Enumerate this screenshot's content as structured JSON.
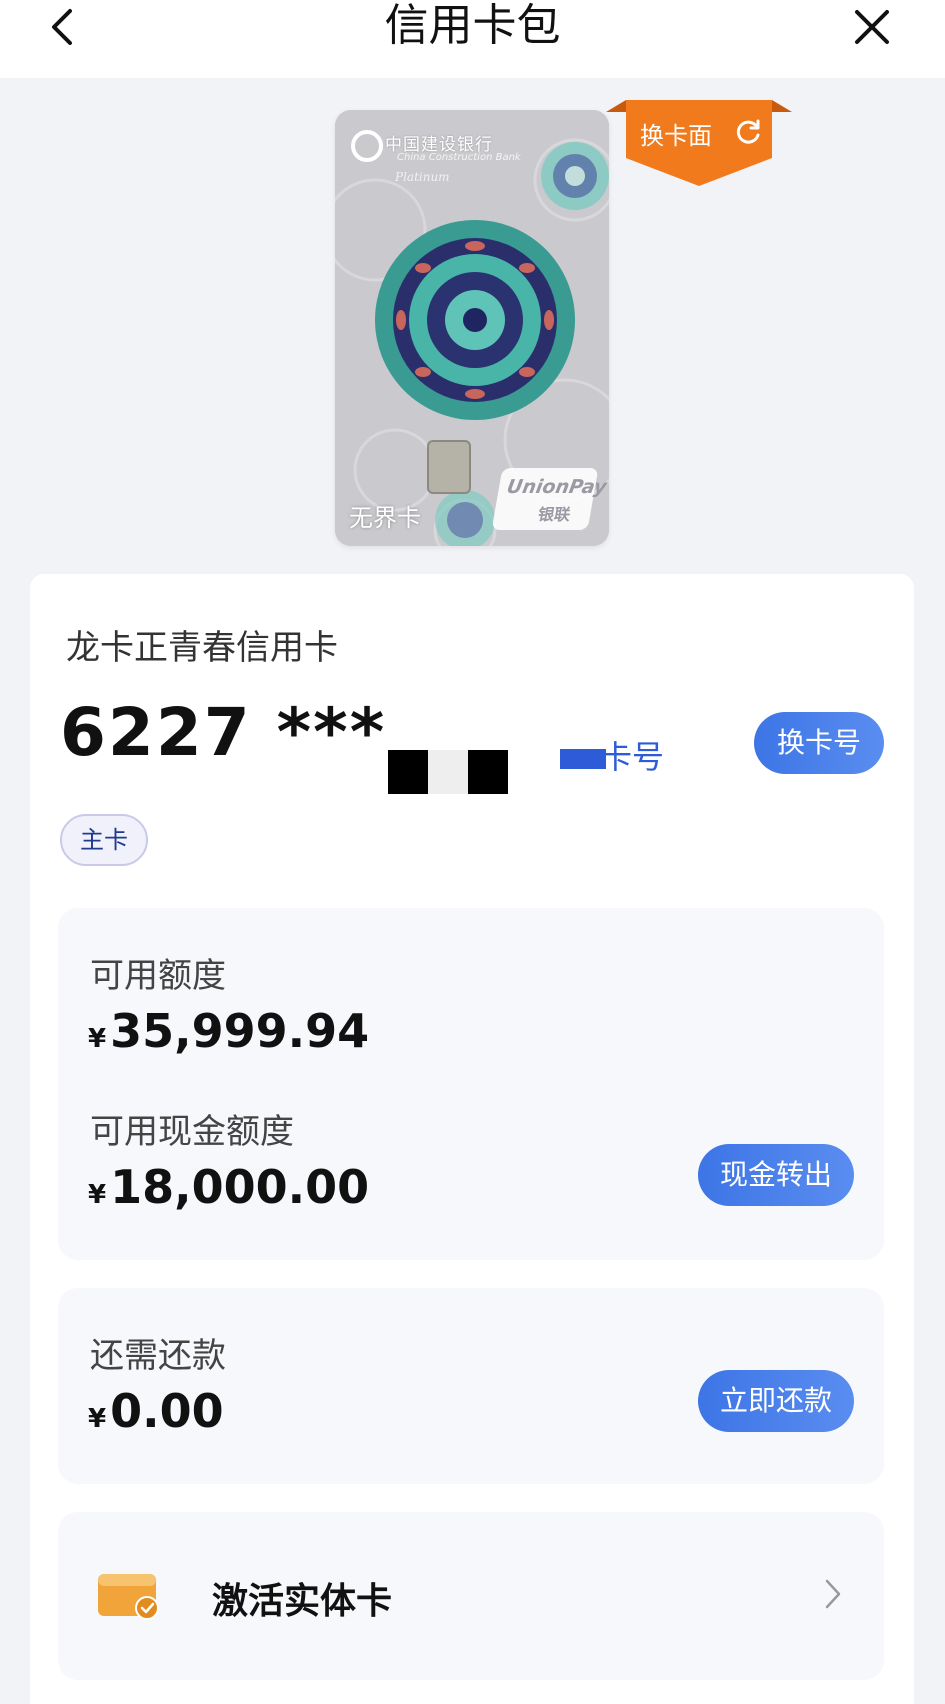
{
  "header": {
    "title": "信用卡包"
  },
  "card": {
    "bank_name": "中国建设银行",
    "bank_name_en": "China Construction Bank",
    "tier": "Platinum",
    "product_label": "无界卡",
    "network_en": "UnionPay",
    "network_cn": "银联",
    "switch_face_label": "换卡面"
  },
  "account": {
    "product_name": "龙卡正青春信用卡",
    "card_number_prefix": "6227 ***",
    "view_number_label": "卡号",
    "switch_number_label": "换卡号",
    "badge": "主卡"
  },
  "credit": {
    "available_label": "可用额度",
    "available_currency": "¥",
    "available_value": "35,999.94",
    "cash_label": "可用现金额度",
    "cash_currency": "¥",
    "cash_value": "18,000.00",
    "cash_button": "现金转出"
  },
  "repayment": {
    "label": "还需还款",
    "currency": "¥",
    "value": "0.00",
    "button": "立即还款"
  },
  "activate": {
    "label": "激活实体卡"
  },
  "colors": {
    "accent": "#3d75e6",
    "ribbon": "#f07a1c",
    "page_bg": "#f2f3f7"
  },
  "icons": {
    "back": "chevron-left-icon",
    "close": "close-icon",
    "refresh": "refresh-icon",
    "wallet": "card-wallet-icon",
    "chevron": "chevron-right-icon"
  }
}
